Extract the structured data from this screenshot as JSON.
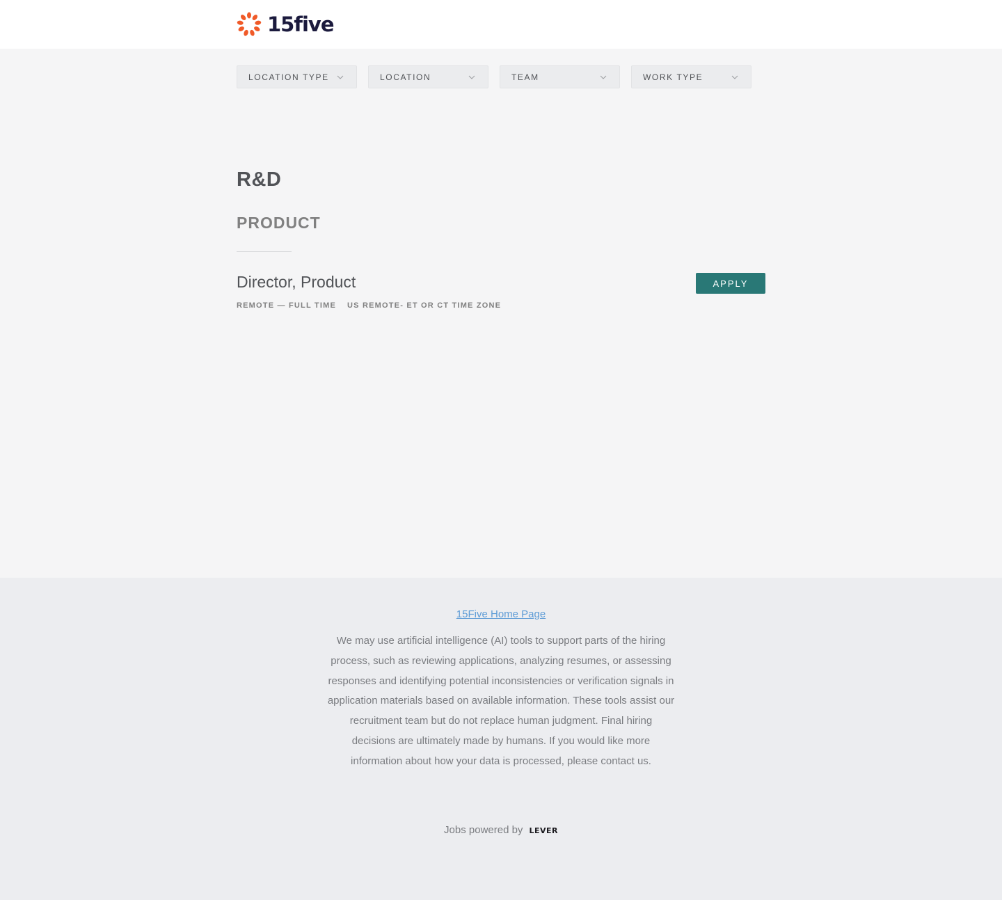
{
  "header": {
    "brand": "15five",
    "logo_color": "#f05a28"
  },
  "filters": [
    {
      "label": "LOCATION TYPE"
    },
    {
      "label": "LOCATION"
    },
    {
      "label": "TEAM"
    },
    {
      "label": "WORK TYPE"
    }
  ],
  "department": "R&D",
  "team": "PRODUCT",
  "posting": {
    "title": "Director, Product",
    "commitment": "REMOTE — FULL TIME",
    "location": "US REMOTE- ET OR CT TIME ZONE",
    "apply_label": "APPLY",
    "apply_color": "#297876"
  },
  "footer": {
    "home_link": "15Five Home Page",
    "notice": "We may use artificial intelligence (AI) tools to support parts of the hiring process, such as reviewing applications, analyzing resumes, or assessing responses and identifying potential inconsistencies or verification signals in application materials based on available information. These tools assist our recruitment team but do not replace human judgment. Final hiring decisions are ultimately made by humans. If you would like more information about how your data is processed, please contact us.",
    "powered_by": "Jobs powered by",
    "lever_label": "LEVER"
  }
}
